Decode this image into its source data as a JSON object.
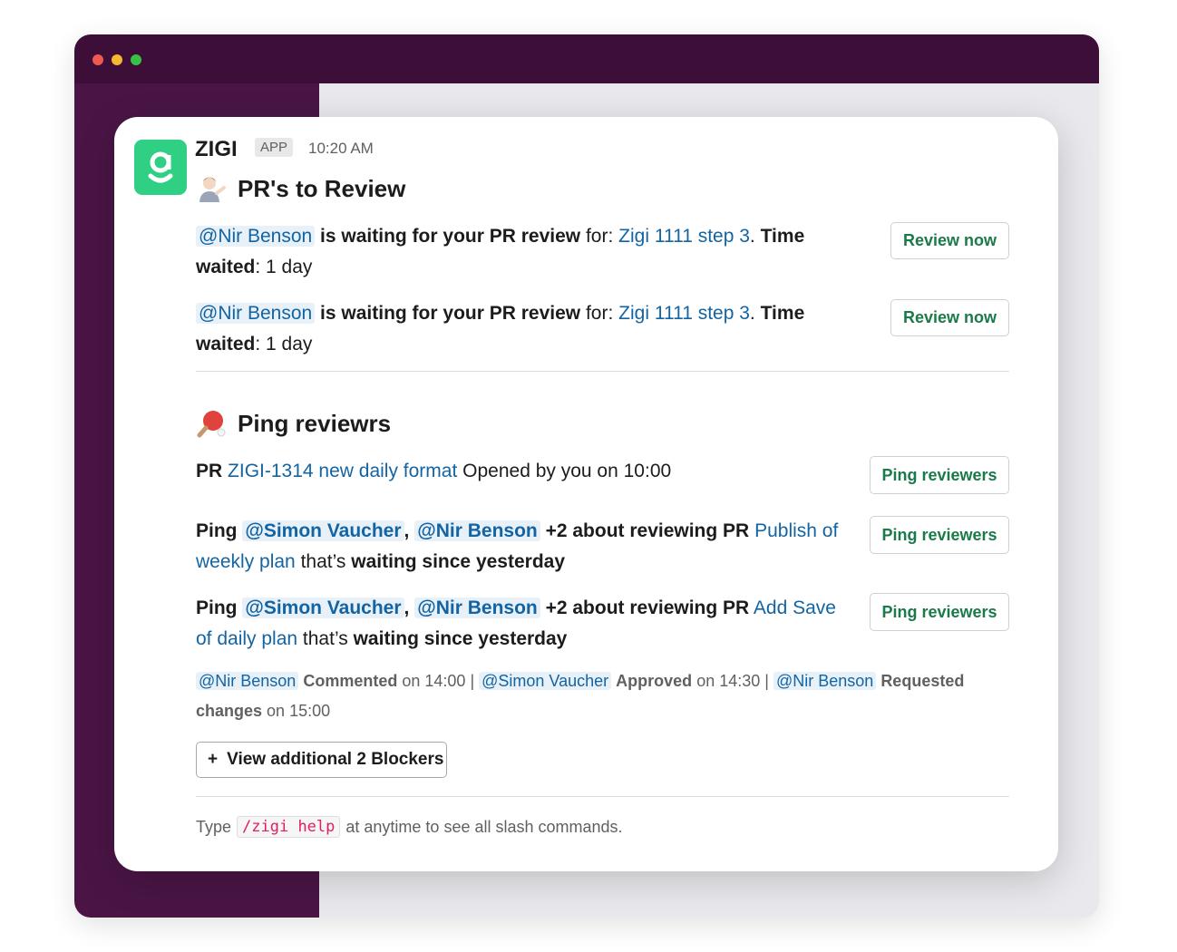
{
  "window": {
    "colors": {
      "titlebar": "#3d0e37",
      "sidebar": "#4a1545",
      "accent_green": "#2fcf84"
    }
  },
  "message": {
    "app_name": "ZIGI",
    "app_badge": "APP",
    "timestamp": "10:20 AM",
    "logo_icon": "zigi-g-logo-icon"
  },
  "review_section": {
    "title": "PR's to Review",
    "emoji_icon": "person-tipping-hand-emoji",
    "items": [
      {
        "mention": "@Nir Benson",
        "text1": "is waiting for your PR review",
        "text2": "for:",
        "link": "Zigi 1111 step 3",
        "punct": ".",
        "time_label_1": "Time",
        "time_label_2": "waited",
        "time_value": ": 1 day",
        "button": "Review now"
      },
      {
        "mention": "@Nir Benson",
        "text1": "is waiting for your PR review",
        "text2": "for:",
        "link": "Zigi 1111 step 3",
        "punct": ".",
        "time_label_1": "Time",
        "time_label_2": "waited",
        "time_value": ": 1 day",
        "button": "Review now"
      }
    ]
  },
  "ping_section": {
    "title": "Ping reviewrs",
    "emoji_icon": "ping-pong-emoji",
    "pr_line": {
      "prefix": "PR",
      "link": "ZIGI-1314 new daily format",
      "suffix": "Opened by you on 10:00",
      "button": "Ping reviewers"
    },
    "items": [
      {
        "ping": "Ping",
        "mention1": "@Simon Vaucher",
        "comma": ",",
        "mention2": "@Nir Benson",
        "text": "+2 about reviewing PR",
        "link": "Publish of weekly plan",
        "that": "that’s",
        "waiting": "waiting since yesterday",
        "button": "Ping reviewers"
      },
      {
        "ping": "Ping",
        "mention1": "@Simon Vaucher",
        "comma": ",",
        "mention2": "@Nir Benson",
        "text": "+2 about reviewing PR",
        "link": "Add Save of daily plan",
        "that": "that’s",
        "waiting": "waiting since yesterday",
        "button": "Ping reviewers"
      }
    ],
    "activity": {
      "m1": "@Nir Benson",
      "a1": "Commented",
      "t1": "on 14:00 |",
      "m2": "@Simon Vaucher",
      "a2": "Approved",
      "t2": "on 14:30 |",
      "m3": "@Nir Benson",
      "a3": "Requested changes",
      "t3": "on 15:00"
    },
    "blockers_button": {
      "plus": "+",
      "label": "View additional 2 Blockers"
    }
  },
  "footer": {
    "prefix": "Type",
    "command": "/zigi help",
    "suffix": "at anytime to see all slash commands."
  }
}
